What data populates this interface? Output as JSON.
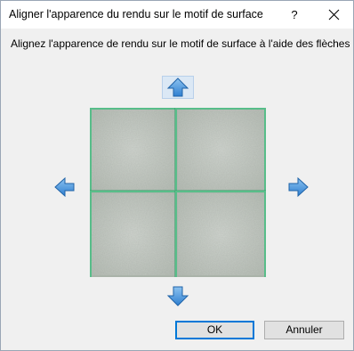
{
  "window": {
    "title": "Aligner l'apparence du rendu sur le motif de surface",
    "help_label": "?"
  },
  "instruction": "Alignez l'apparence de rendu sur le motif de surface à l'aide des flèches",
  "buttons": {
    "ok_label": "OK",
    "cancel_label": "Annuler"
  },
  "arrows": {
    "up_icon": "arrow-up-icon",
    "down_icon": "arrow-down-icon",
    "left_icon": "arrow-left-icon",
    "right_icon": "arrow-right-icon",
    "color": "#4a90d9"
  },
  "preview": {
    "tile_color": "#c3c9c2",
    "grout_color": "#4fbf86",
    "columns": 2,
    "rows": 2
  },
  "colors": {
    "dialog_bg": "#f0f0f0",
    "titlebar_bg": "#ffffff",
    "accent": "#0078d7"
  }
}
